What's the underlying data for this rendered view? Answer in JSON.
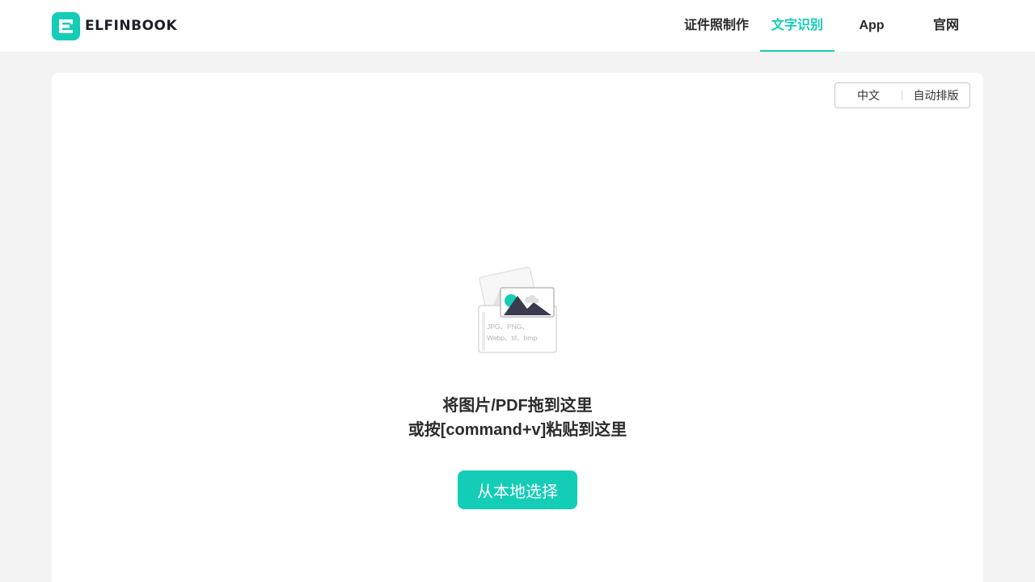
{
  "brand": {
    "name": "ELFINBOOK",
    "accent_color": "#14cdb6"
  },
  "nav": {
    "items": [
      {
        "label": "证件照制作",
        "active": false
      },
      {
        "label": "文字识别",
        "active": true
      },
      {
        "label": "App",
        "active": false
      },
      {
        "label": "官网",
        "active": false
      }
    ]
  },
  "options": {
    "language": "中文",
    "layout_mode": "自动排版"
  },
  "dropzone": {
    "illustration_formats_line1": "JPG、PNG、",
    "illustration_formats_line2": "Webp、tif、bmp",
    "line1": "将图片/PDF拖到这里",
    "line2": "或按[command+v]粘贴到这里",
    "button_label": "从本地选择"
  }
}
